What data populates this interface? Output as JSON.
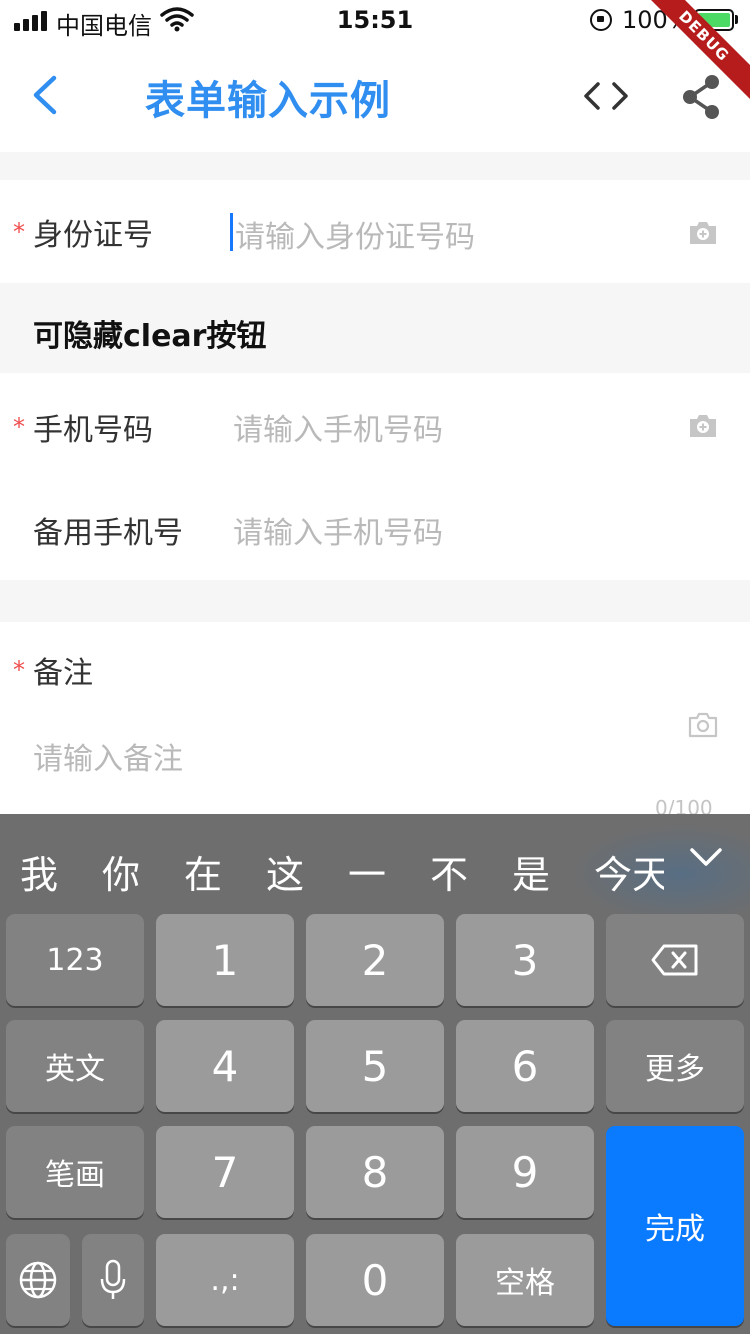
{
  "status_bar": {
    "carrier": "中国电信",
    "time": "15:51",
    "battery_percent": "100%",
    "battery_level": 1.0
  },
  "debug_banner": "DEBUG",
  "nav": {
    "title": "表单输入示例",
    "back_icon": "chevron-left-icon",
    "code_icon": "code-brackets-icon",
    "share_icon": "share-icon",
    "accent_color": "#2f8ef0"
  },
  "form": {
    "id_field": {
      "required_mark": "*",
      "label": "身份证号",
      "placeholder": "请输入身份证号码",
      "icon": "camera-icon"
    },
    "section_title": "可隐藏clear按钮",
    "phone_field": {
      "required_mark": "*",
      "label": "手机号码",
      "placeholder": "请输入手机号码",
      "icon": "camera-icon"
    },
    "backup_phone_field": {
      "label": "备用手机号",
      "placeholder": "请输入手机号码"
    },
    "notes_field": {
      "required_mark": "*",
      "label": "备注",
      "placeholder": "请输入备注",
      "icon": "camera-icon",
      "counter": "0/100"
    },
    "required_color": "#f04e4e"
  },
  "keyboard": {
    "suggestions": [
      "我",
      "你",
      "在",
      "这",
      "一",
      "不",
      "是",
      "今天"
    ],
    "collapse_icon": "chevron-down-icon",
    "keys": {
      "mode_123": "123",
      "k1": "1",
      "k2": "2",
      "k3": "3",
      "backspace_icon": "backspace-icon",
      "english": "英文",
      "k4": "4",
      "k5": "5",
      "k6": "6",
      "more": "更多",
      "stroke": "笔画",
      "k7": "7",
      "k8": "8",
      "k9": "9",
      "done": "完成",
      "globe_icon": "globe-icon",
      "mic_icon": "microphone-icon",
      "punct": ".,:",
      "k0": "0",
      "space": "空格"
    },
    "done_color": "#0a7aff"
  }
}
